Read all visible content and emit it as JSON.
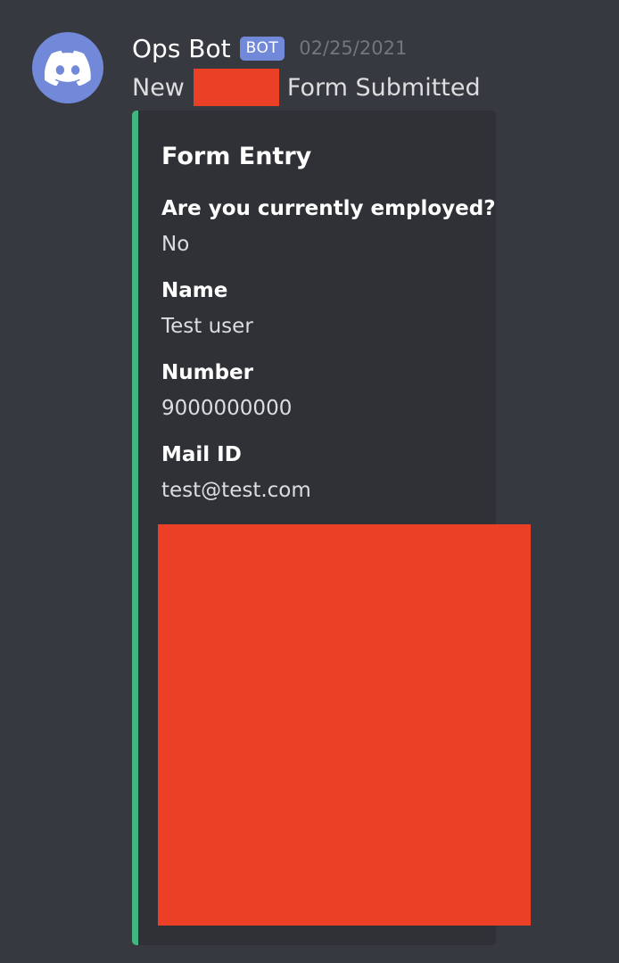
{
  "message": {
    "author": "Ops Bot",
    "bot_tag": "BOT",
    "timestamp": "02/25/2021",
    "content_before": "New",
    "content_after": "Form Submitted",
    "avatar_icon": "discord-logo-icon"
  },
  "embed": {
    "accent_color": "#43b581",
    "title": "Form Entry",
    "fields": [
      {
        "name": "Are you currently employed?",
        "value": "No"
      },
      {
        "name": "Name",
        "value": "Test user"
      },
      {
        "name": "Number",
        "value": "9000000000"
      },
      {
        "name": "Mail ID",
        "value": "test@test.com"
      }
    ]
  },
  "colors": {
    "background": "#36393f",
    "embed_background": "#2f3136",
    "bot_tag": "#7289da",
    "redaction": "#eb4025"
  }
}
